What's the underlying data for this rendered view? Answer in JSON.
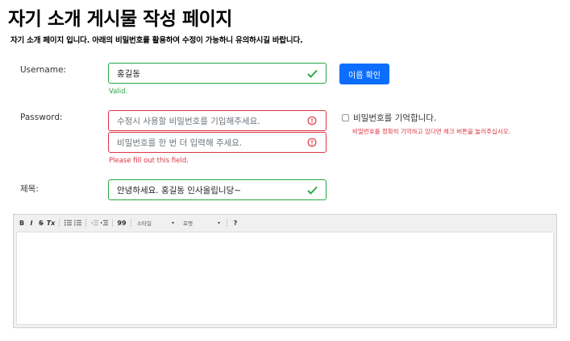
{
  "page": {
    "title": "자기 소개 게시물 작성 페이지",
    "description": "자기 소개 페이지 입니다. 아래의 비밀번호를 활용하여 수정이 가능하니 유의하시길 바랍니다."
  },
  "form": {
    "username": {
      "label": "Username:",
      "value": "홍길동",
      "feedback": "Valid.",
      "check_button": "이름 확인"
    },
    "password": {
      "label": "Password:",
      "placeholder": "수정시 사용할 비밀번호를 기입해주세요.",
      "confirm_placeholder": "비밀번호를 한 번 더 입력해 주세요.",
      "feedback": "Please fill out this field.",
      "remember_label": "비밀번호를 기억합니다.",
      "remember_help": "비밀번호를 정확히 기억하고 있다면 체크 버튼을 눌러주십시오."
    },
    "subject": {
      "label": "제목:",
      "value": "안녕하세요. 홍길동 인사올립니당~"
    }
  },
  "editor": {
    "toolbar": {
      "bold": "B",
      "italic": "I",
      "strike": "S",
      "clear_format": "Tx",
      "numbered_list_icon": "numbered-list-icon",
      "bulleted_list_icon": "bulleted-list-icon",
      "outdent_icon": "outdent-icon",
      "indent_icon": "indent-icon",
      "blockquote": "99",
      "style_select": "스타일",
      "format_select": "포맷",
      "help": "?"
    }
  },
  "colors": {
    "valid": "#28a745",
    "invalid": "#dc3545",
    "primary": "#0d6efd"
  }
}
